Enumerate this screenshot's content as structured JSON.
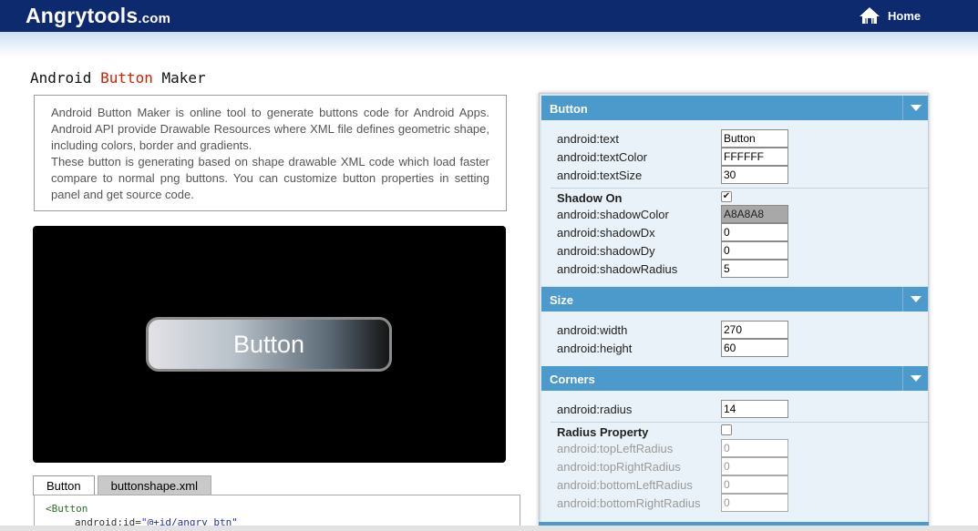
{
  "header": {
    "logo_main": "Angrytools",
    "logo_domain": ".com",
    "home_label": "Home",
    "bg_color": "#0e2a6e"
  },
  "page": {
    "title_part1": "Android ",
    "title_accent": "Button",
    "title_part2": " Maker",
    "description_p1": "Android Button Maker is online tool to generate buttons code for Android Apps. Android API provide Drawable Resources where XML file defines geometric shape, including colors, border and gradients.",
    "description_p2": "These button is generating based on shape drawable XML code which load faster compare to normal png buttons. You can customize button properties in setting panel and get source code."
  },
  "preview": {
    "button_text": "Button"
  },
  "tabs": [
    {
      "label": "Button",
      "active": true
    },
    {
      "label": "buttonshape.xml",
      "active": false
    }
  ],
  "code": {
    "line1": "<Button",
    "line2_attr": "android:id=",
    "line2_val": "\"@+id/angry_btn\""
  },
  "panel": {
    "accent_color": "#4c9acc",
    "button_section": {
      "title": "Button",
      "text_label": "android:text",
      "text_value": "Button",
      "textColor_label": "android:textColor",
      "textColor_value": "FFFFFF",
      "textSize_label": "android:textSize",
      "textSize_value": "30",
      "shadow_on_label": "Shadow On",
      "shadow_on_checked": true,
      "shadowColor_label": "android:shadowColor",
      "shadowColor_value": "A8A8A8",
      "shadowDx_label": "android:shadowDx",
      "shadowDx_value": "0",
      "shadowDy_label": "android:shadowDy",
      "shadowDy_value": "0",
      "shadowRadius_label": "android:shadowRadius",
      "shadowRadius_value": "5"
    },
    "size_section": {
      "title": "Size",
      "width_label": "android:width",
      "width_value": "270",
      "height_label": "android:height",
      "height_value": "60"
    },
    "corners_section": {
      "title": "Corners",
      "radius_label": "android:radius",
      "radius_value": "14",
      "radius_property_label": "Radius Property",
      "radius_property_checked": false,
      "topLeft_label": "android:topLeftRadius",
      "topLeft_value": "0",
      "topRight_label": "android:topRightRadius",
      "topRight_value": "0",
      "bottomLeft_label": "android:bottomLeftRadius",
      "bottomLeft_value": "0",
      "bottomRight_label": "android:bottomRightRadius",
      "bottomRight_value": "0"
    }
  }
}
